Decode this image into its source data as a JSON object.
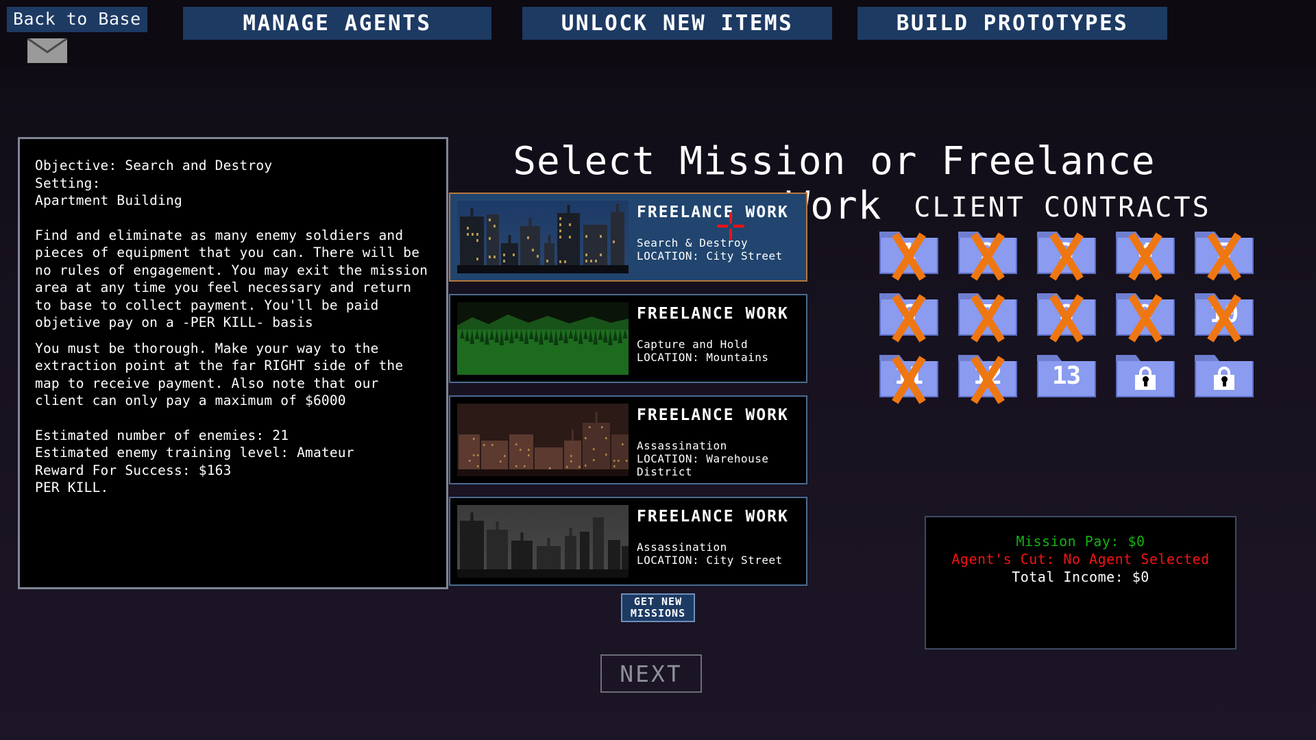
{
  "topbar": {
    "back_label": "Back to Base",
    "mail_icon": "envelope-icon",
    "nav": [
      {
        "label": "MANAGE AGENTS"
      },
      {
        "label": "UNLOCK NEW ITEMS"
      },
      {
        "label": "BUILD PROTOTYPES"
      }
    ]
  },
  "briefing": {
    "objective": "Objective: Search and Destroy",
    "setting_label": "Setting:",
    "setting_value": "Apartment Building",
    "para1": "Find and eliminate as many enemy soldiers and pieces of equipment that you can.  There will be no rules of engagement.  You may exit the mission area at any time you feel necessary and return to base to collect payment.  You'll be paid objetive pay on a -PER KILL- basis",
    "para2": "You must be thorough.  Make your way to the extraction point at the far RIGHT side of the map to receive payment.  Also note that our client can only pay a maximum of $6000",
    "enemies": "Estimated number of enemies: 21",
    "training": "Estimated enemy training level: Amateur",
    "reward": "Reward For Success: $163",
    "per_kill": "PER KILL."
  },
  "main": {
    "title": "Select Mission or Freelance Work",
    "get_new_line1": "GET  NEW",
    "get_new_line2": "MISSIONS",
    "next_label": "NEXT",
    "missions": [
      {
        "title": "FREELANCE WORK",
        "type": "Search & Destroy",
        "location": "LOCATION: City Street",
        "scene": "city-night",
        "selected": true
      },
      {
        "title": "FREELANCE WORK",
        "type": "Capture and Hold",
        "location": "LOCATION: Mountains",
        "scene": "mountains",
        "selected": false
      },
      {
        "title": "FREELANCE WORK",
        "type": "Assassination",
        "location": "LOCATION: Warehouse District",
        "scene": "warehouse",
        "selected": false
      },
      {
        "title": "FREELANCE WORK",
        "type": "Assassination",
        "location": "LOCATION: City Street",
        "scene": "city-grey",
        "selected": false
      }
    ]
  },
  "contracts": {
    "title": "CLIENT CONTRACTS",
    "folders": [
      {
        "label": "1",
        "state": "completed"
      },
      {
        "label": "2",
        "state": "completed"
      },
      {
        "label": "3",
        "state": "completed"
      },
      {
        "label": "4",
        "state": "completed"
      },
      {
        "label": "5",
        "state": "completed"
      },
      {
        "label": "6",
        "state": "completed"
      },
      {
        "label": "7",
        "state": "completed"
      },
      {
        "label": "8",
        "state": "completed"
      },
      {
        "label": "9",
        "state": "completed"
      },
      {
        "label": "10",
        "state": "completed"
      },
      {
        "label": "11",
        "state": "completed"
      },
      {
        "label": "12",
        "state": "completed"
      },
      {
        "label": "13",
        "state": "available"
      },
      {
        "label": "",
        "state": "locked"
      },
      {
        "label": "",
        "state": "locked"
      }
    ]
  },
  "income": {
    "mission_pay": "Mission Pay: $0",
    "agents_cut": "Agent's Cut: No Agent Selected",
    "total_income": "Total Income: $0"
  },
  "colors": {
    "accent_blue": "#1d3a63",
    "selected_border": "#b5783c",
    "folder_blue": "#8a9bf0",
    "x_orange": "#ef7712",
    "pay_green": "#12b312",
    "cut_red": "#f31414",
    "crosshair_red": "#ff1010"
  }
}
